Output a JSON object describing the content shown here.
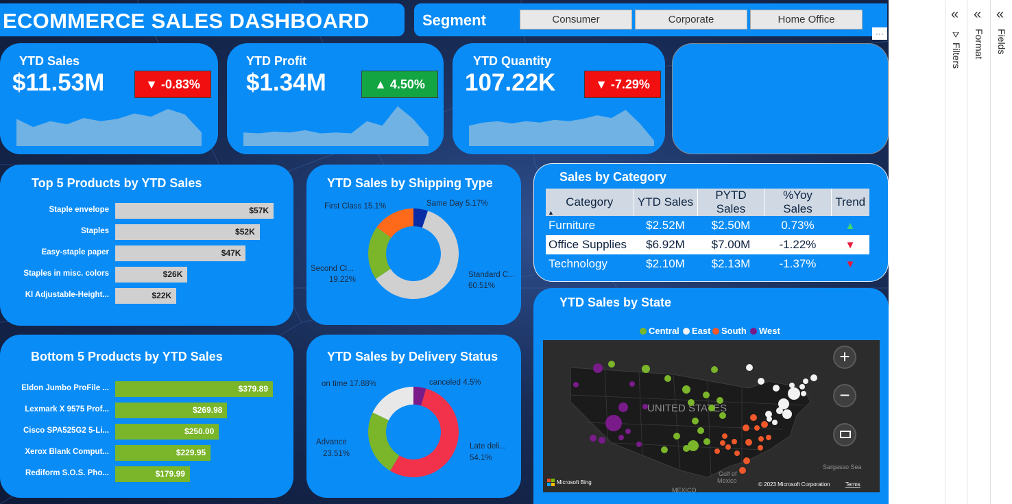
{
  "header": {
    "title": "ECOMMERCE SALES DASHBOARD"
  },
  "segment": {
    "label": "Segment",
    "options": [
      "Consumer",
      "Corporate",
      "Home Office"
    ]
  },
  "kpis": [
    {
      "title": "YTD Sales",
      "value": "$11.53M",
      "change": "▼ -0.83%",
      "direction": "down",
      "trend": [
        60,
        42,
        55,
        48,
        62,
        55,
        60,
        72,
        65,
        82,
        70,
        30
      ]
    },
    {
      "title": "YTD Profit",
      "value": "$1.34M",
      "change": "▲ 4.50%",
      "direction": "up",
      "trend": [
        30,
        28,
        32,
        30,
        35,
        28,
        30,
        28,
        55,
        45,
        88,
        60,
        20
      ]
    },
    {
      "title": "YTD Quantity",
      "value": "107.22K",
      "change": "▼ -7.29%",
      "direction": "down",
      "trend": [
        45,
        52,
        55,
        50,
        55,
        52,
        58,
        55,
        60,
        68,
        62,
        80,
        50,
        12
      ]
    }
  ],
  "top5": {
    "title": "Top 5 Products by YTD Sales",
    "items": [
      {
        "label": "Staple envelope",
        "value": 57,
        "display": "$57K"
      },
      {
        "label": "Staples",
        "value": 52,
        "display": "$52K"
      },
      {
        "label": "Easy-staple paper",
        "value": 47,
        "display": "$47K"
      },
      {
        "label": "Staples in misc. colors",
        "value": 26,
        "display": "$26K"
      },
      {
        "label": "Kl Adjustable-Height...",
        "value": 22,
        "display": "$22K"
      }
    ]
  },
  "bottom5": {
    "title": "Bottom 5 Products by YTD Sales",
    "items": [
      {
        "label": "Eldon Jumbo ProFile ...",
        "value": 379.89,
        "display": "$379.89"
      },
      {
        "label": "Lexmark X 9575 Prof...",
        "value": 269.98,
        "display": "$269.98"
      },
      {
        "label": "Cisco SPA525G2 5-Li...",
        "value": 250.0,
        "display": "$250.00"
      },
      {
        "label": "Xerox Blank Comput...",
        "value": 229.95,
        "display": "$229.95"
      },
      {
        "label": "Rediform S.O.S. Pho...",
        "value": 179.99,
        "display": "$179.99"
      }
    ]
  },
  "shipping": {
    "title": "YTD Sales by Shipping Type",
    "labels": {
      "same_day": "Same Day 5.17%",
      "first_class": "First Class 15.1%",
      "second_class_1": "Second Cl...",
      "second_class_2": "19.22%",
      "standard_1": "Standard C...",
      "standard_2": "60.51%"
    }
  },
  "delivery": {
    "title": "YTD Sales by Delivery Status",
    "labels": {
      "canceled": "canceled 4.5%",
      "on_time": "on time 17.88%",
      "advance_1": "Advance",
      "advance_2": "23.51%",
      "late_1": "Late deli...",
      "late_2": "54.1%"
    }
  },
  "category_table": {
    "title": "Sales by Category",
    "headers": [
      "Category",
      "YTD Sales",
      "PYTD Sales",
      "%Yoy Sales",
      "Trend"
    ],
    "rows": [
      {
        "category": "Furniture",
        "ytd": "$2.52M",
        "pytd": "$2.50M",
        "yoy": "0.73%",
        "trend": "▲"
      },
      {
        "category": "Office Supplies",
        "ytd": "$6.92M",
        "pytd": "$7.00M",
        "yoy": "-1.22%",
        "trend": "▼"
      },
      {
        "category": "Technology",
        "ytd": "$2.10M",
        "pytd": "$2.13M",
        "yoy": "-1.37%",
        "trend": "▼"
      }
    ]
  },
  "state_map": {
    "title": "YTD Sales by State",
    "legend": [
      {
        "name": "Central",
        "color": "#7ab52a"
      },
      {
        "name": "East",
        "color": "#f2f2f2"
      },
      {
        "name": "South",
        "color": "#f0582a"
      },
      {
        "name": "West",
        "color": "#7a1b8a"
      }
    ],
    "country_label": "UNITED STATES",
    "gulf_label_1": "Gulf of",
    "gulf_label_2": "Mexico",
    "sea_label": "Sargasso Sea",
    "mexico_label": "MEXICO",
    "bing_label": "Microsoft Bing",
    "copyright": "© 2023 Microsoft Corporation",
    "terms": "Terms"
  },
  "pane": {
    "filters": "Filters",
    "format": "Format",
    "fields": "Fields",
    "collapse": "«"
  },
  "more_options": "···",
  "colors": {
    "panel": "#0a8cf7",
    "down": "#f20f10",
    "up": "#13a542",
    "top_bar": "#d0d0d0",
    "bottom_bar": "#7ab52a",
    "spark": "#6fb2e3"
  },
  "chart_data": [
    {
      "type": "bar",
      "title": "Top 5 Products by YTD Sales",
      "categories": [
        "Staple envelope",
        "Staples",
        "Easy-staple paper",
        "Staples in misc. colors",
        "Kl Adjustable-Height..."
      ],
      "values": [
        57,
        52,
        47,
        26,
        22
      ]
    },
    {
      "type": "bar",
      "title": "Bottom 5 Products by YTD Sales",
      "categories": [
        "Eldon Jumbo ProFile ...",
        "Lexmark X 9575 Prof...",
        "Cisco SPA525G2 5-Li...",
        "Xerox Blank Comput...",
        "Rediform S.O.S. Pho..."
      ],
      "values": [
        379.89,
        269.98,
        250.0,
        229.95,
        179.99
      ]
    },
    {
      "type": "pie",
      "title": "YTD Sales by Shipping Type",
      "categories": [
        "Same Day",
        "Standard C...",
        "Second Cl...",
        "First Class"
      ],
      "values": [
        5.17,
        60.51,
        19.22,
        15.1
      ],
      "colors": [
        "#0a2da6",
        "#d0d0d0",
        "#7ab52a",
        "#ff6a1a"
      ]
    },
    {
      "type": "pie",
      "title": "YTD Sales by Delivery Status",
      "categories": [
        "canceled",
        "Late deli...",
        "Advance",
        "on time"
      ],
      "values": [
        4.5,
        54.1,
        23.51,
        17.88
      ],
      "colors": [
        "#7a1b8a",
        "#f2314a",
        "#7ab52a",
        "#e8e8e8"
      ]
    },
    {
      "type": "table",
      "title": "Sales by Category",
      "columns": [
        "Category",
        "YTD Sales",
        "PYTD Sales",
        "%Yoy Sales",
        "Trend"
      ],
      "rows": [
        [
          "Furniture",
          "$2.52M",
          "$2.50M",
          "0.73%",
          "▲"
        ],
        [
          "Office Supplies",
          "$6.92M",
          "$7.00M",
          "-1.22%",
          "▼"
        ],
        [
          "Technology",
          "$2.10M",
          "$2.13M",
          "-1.37%",
          "▼"
        ]
      ]
    }
  ]
}
